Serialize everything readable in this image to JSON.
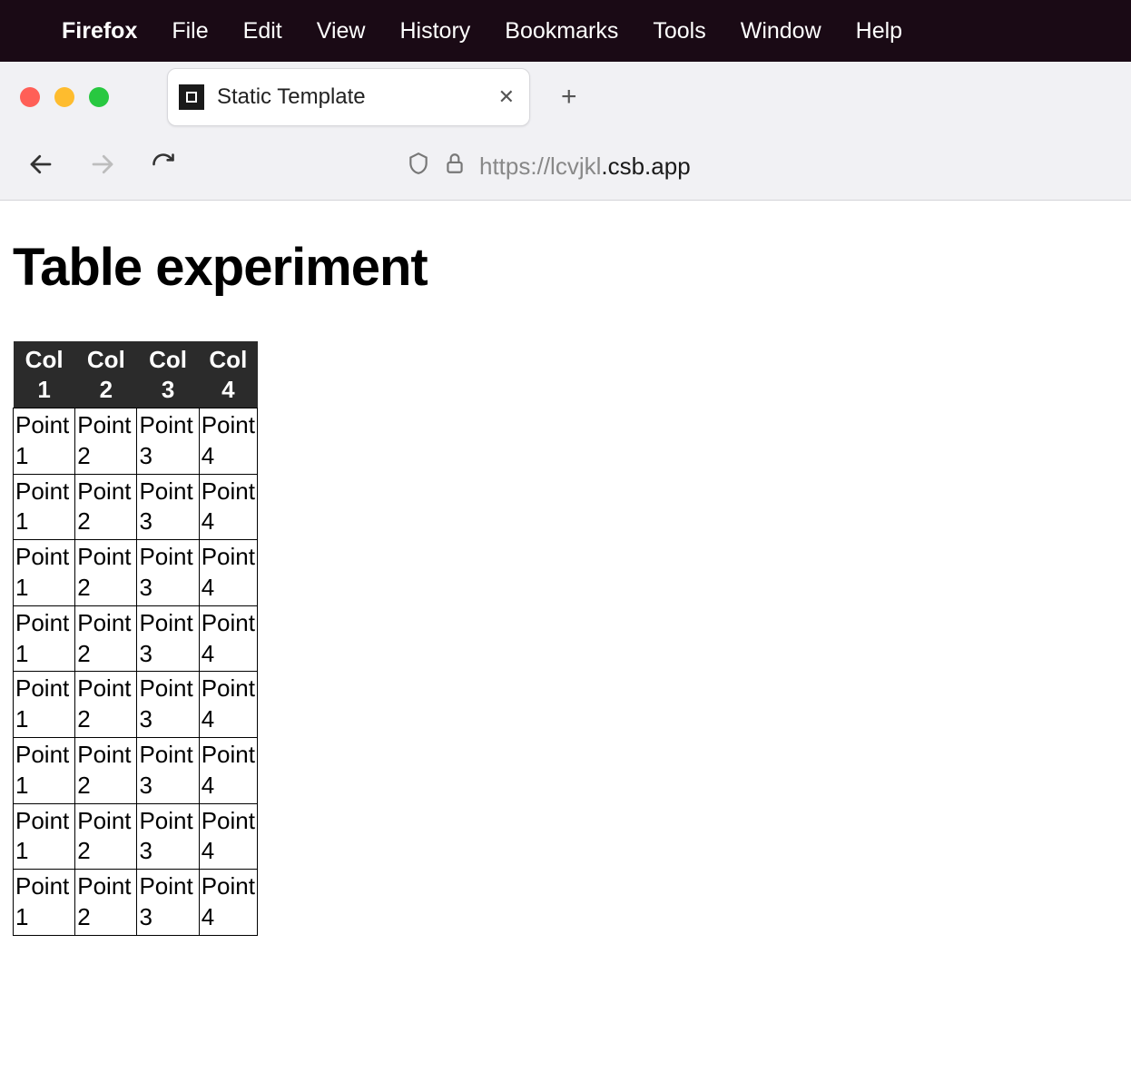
{
  "menubar": {
    "app": "Firefox",
    "items": [
      "File",
      "Edit",
      "View",
      "History",
      "Bookmarks",
      "Tools",
      "Window",
      "Help"
    ]
  },
  "browser": {
    "tab": {
      "title": "Static Template"
    },
    "url": {
      "protocol_host_prefix": "https://lcvjkl",
      "domain_suffix": ".csb.app"
    }
  },
  "page": {
    "title": "Table experiment",
    "table": {
      "headers": [
        "Col 1",
        "Col 2",
        "Col 3",
        "Col 4"
      ],
      "rows": [
        [
          "Point 1",
          "Point 2",
          "Point 3",
          "Point 4"
        ],
        [
          "Point 1",
          "Point 2",
          "Point 3",
          "Point 4"
        ],
        [
          "Point 1",
          "Point 2",
          "Point 3",
          "Point 4"
        ],
        [
          "Point 1",
          "Point 2",
          "Point 3",
          "Point 4"
        ],
        [
          "Point 1",
          "Point 2",
          "Point 3",
          "Point 4"
        ],
        [
          "Point 1",
          "Point 2",
          "Point 3",
          "Point 4"
        ],
        [
          "Point 1",
          "Point 2",
          "Point 3",
          "Point 4"
        ],
        [
          "Point 1",
          "Point 2",
          "Point 3",
          "Point 4"
        ]
      ]
    }
  }
}
